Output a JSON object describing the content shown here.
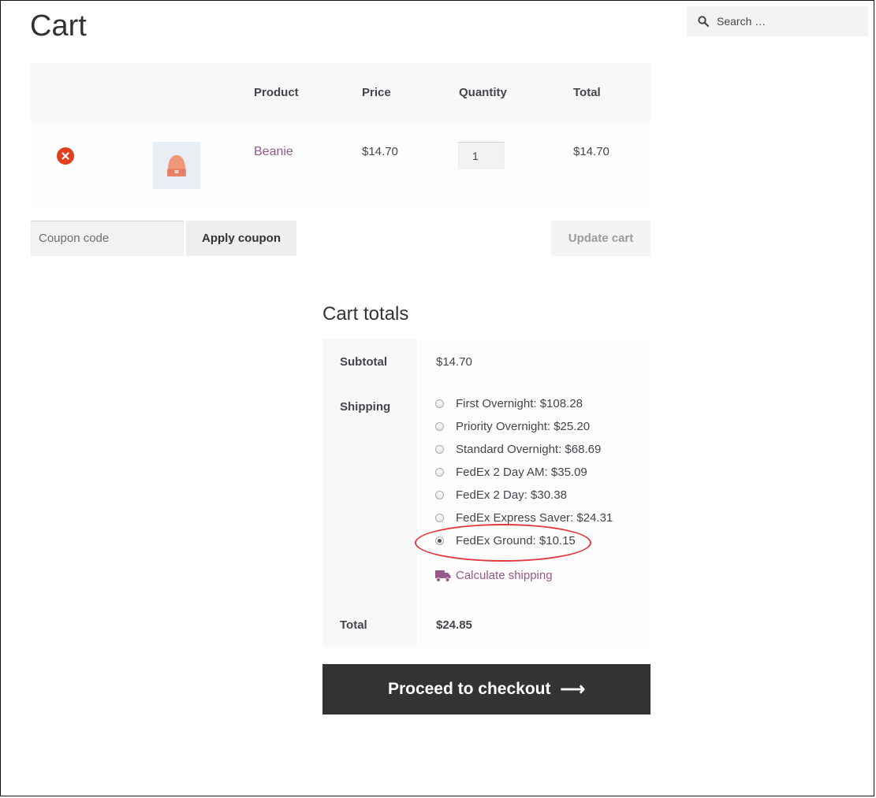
{
  "page": {
    "title": "Cart"
  },
  "search": {
    "placeholder": "Search …"
  },
  "cart_table": {
    "headers": {
      "product": "Product",
      "price": "Price",
      "quantity": "Quantity",
      "total": "Total"
    },
    "rows": [
      {
        "product": "Beanie",
        "price": "$14.70",
        "quantity": "1",
        "total": "$14.70"
      }
    ]
  },
  "coupon": {
    "placeholder": "Coupon code",
    "apply_label": "Apply coupon"
  },
  "update_cart_label": "Update cart",
  "totals": {
    "title": "Cart totals",
    "subtotal_label": "Subtotal",
    "subtotal_value": "$14.70",
    "shipping_label": "Shipping",
    "shipping_options": [
      {
        "label": "First Overnight: $108.28",
        "selected": false
      },
      {
        "label": "Priority Overnight: $25.20",
        "selected": false
      },
      {
        "label": "Standard Overnight: $68.69",
        "selected": false
      },
      {
        "label": "FedEx 2 Day AM: $35.09",
        "selected": false
      },
      {
        "label": "FedEx 2 Day: $30.38",
        "selected": false
      },
      {
        "label": "FedEx Express Saver: $24.31",
        "selected": false
      },
      {
        "label": "FedEx Ground: $10.15",
        "selected": true
      }
    ],
    "calculate_shipping_label": "Calculate shipping",
    "total_label": "Total",
    "total_value": "$24.85"
  },
  "checkout": {
    "label": "Proceed to checkout",
    "arrow": "⟶"
  },
  "colors": {
    "link": "#96588a",
    "remove": "#e2401c",
    "checkout_bg": "#333333",
    "highlight": "#e0393e"
  }
}
